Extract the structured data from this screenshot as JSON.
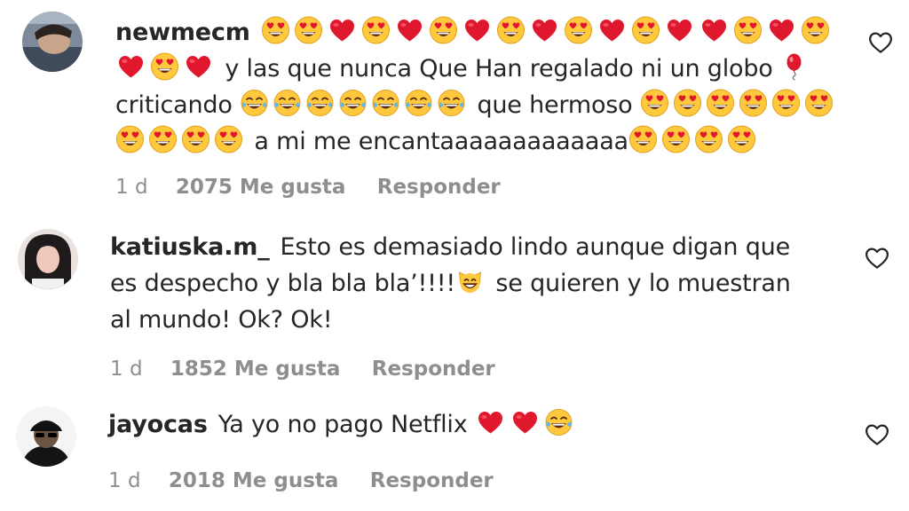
{
  "comments": [
    {
      "username": "newmecm",
      "avatar": "avatar",
      "segments": [
        {
          "e": "heart-eyes"
        },
        {
          "e": "heart-eyes"
        },
        {
          "e": "red-heart"
        },
        {
          "e": "heart-eyes"
        },
        {
          "e": "red-heart"
        },
        {
          "e": "heart-eyes"
        },
        {
          "e": "red-heart"
        },
        {
          "e": "heart-eyes"
        },
        {
          "e": "red-heart"
        },
        {
          "e": "heart-eyes"
        },
        {
          "e": "red-heart"
        },
        {
          "e": "heart-eyes"
        },
        {
          "e": "red-heart"
        },
        {
          "e": "red-heart"
        },
        {
          "e": "heart-eyes"
        },
        {
          "e": "red-heart"
        },
        {
          "e": "heart-eyes"
        },
        {
          "e": "red-heart"
        },
        {
          "e": "heart-eyes"
        },
        {
          "e": "red-heart"
        },
        {
          "t": " y las que nunca Que Han regalado ni un globo "
        },
        {
          "e": "balloon"
        },
        {
          "t": " criticando "
        },
        {
          "e": "tears-of-joy"
        },
        {
          "e": "tears-of-joy"
        },
        {
          "e": "tears-of-joy"
        },
        {
          "e": "tears-of-joy"
        },
        {
          "e": "tears-of-joy"
        },
        {
          "e": "tears-of-joy"
        },
        {
          "e": "tears-of-joy"
        },
        {
          "t": " que hermoso "
        },
        {
          "e": "heart-eyes"
        },
        {
          "e": "heart-eyes"
        },
        {
          "e": "heart-eyes"
        },
        {
          "e": "heart-eyes"
        },
        {
          "e": "heart-eyes"
        },
        {
          "e": "heart-eyes"
        },
        {
          "e": "heart-eyes"
        },
        {
          "e": "heart-eyes"
        },
        {
          "e": "heart-eyes"
        },
        {
          "e": "heart-eyes"
        },
        {
          "t": " a mi me encantaaaaaaaaaaaaa"
        },
        {
          "e": "heart-eyes"
        },
        {
          "e": "heart-eyes"
        },
        {
          "e": "heart-eyes"
        },
        {
          "e": "heart-eyes"
        }
      ],
      "time": "1 d",
      "likes": "2075 Me gusta",
      "reply": "Responder"
    },
    {
      "username": "katiuska.m_",
      "avatar": "avatar",
      "segments": [
        {
          "t": "Esto es demasiado lindo aunque digan que es despecho y bla bla bla’!!!!"
        },
        {
          "e": "cat-grin"
        },
        {
          "t": " se quieren y lo muestran al mundo! Ok? Ok!"
        }
      ],
      "time": "1 d",
      "likes": "1852 Me gusta",
      "reply": "Responder"
    },
    {
      "username": "jayocas",
      "avatar": "avatar",
      "segments": [
        {
          "t": "Ya yo no pago Netflix "
        },
        {
          "e": "red-heart"
        },
        {
          "e": "red-heart"
        },
        {
          "e": "tears-of-joy"
        }
      ],
      "time": "1 d",
      "likes": "2018 Me gusta",
      "reply": "Responder"
    }
  ],
  "colors": {
    "text": "#262626",
    "secondary": "#8e8e8e",
    "heart_red": "#e0182d",
    "emoji_yellow": "#ffc83d"
  },
  "icons": {
    "like": "heart-outline-icon"
  }
}
